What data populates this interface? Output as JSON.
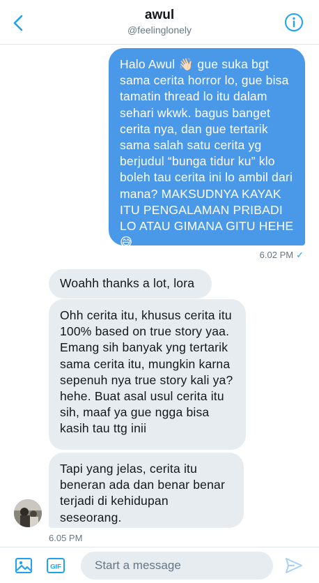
{
  "header": {
    "title": "awul",
    "handle": "@feelinglonely",
    "back_icon": "chevron-left-icon",
    "info_icon": "info-icon"
  },
  "messages": {
    "sent": [
      {
        "text": "Halo Awul 👋🏻 gue suka bgt sama cerita horror lo, gue bisa tamatin thread lo itu dalam sehari wkwk. bagus banget cerita nya, dan gue tertarik sama salah satu cerita yg berjudul “bunga tidur ku” klo boleh tau cerita ini lo ambil dari mana? MAKSUDNYA KAYAK ITU PENGALAMAN PRIBADI LO ATAU GIMANA GITU HEHE 😅",
        "time": "6.02 PM",
        "status": "✓"
      }
    ],
    "received": [
      {
        "text": "Woahh thanks a lot, lora"
      },
      {
        "text": "Ohh cerita itu, khusus cerita itu 100% based on true story yaa. Emang sih banyak yng tertarik sama cerita itu, mungkin karna sepenuh nya true story kali ya? hehe. Buat asal usul cerita itu sih, maaf ya gue ngga bisa kasih tau ttg inii"
      },
      {
        "text": "Tapi yang jelas, cerita itu beneran ada dan benar benar terjadi di kehidupan seseorang."
      }
    ],
    "received_time": "6.05 PM"
  },
  "composer": {
    "placeholder": "Start a message",
    "value": "",
    "image_icon": "image-icon",
    "gif_label": "GIF",
    "send_icon": "send-icon"
  },
  "colors": {
    "accent": "#1da1f2",
    "sent_bubble": "#4a99e9",
    "received_bubble": "#e6ecf0",
    "secondary_text": "#657786"
  }
}
